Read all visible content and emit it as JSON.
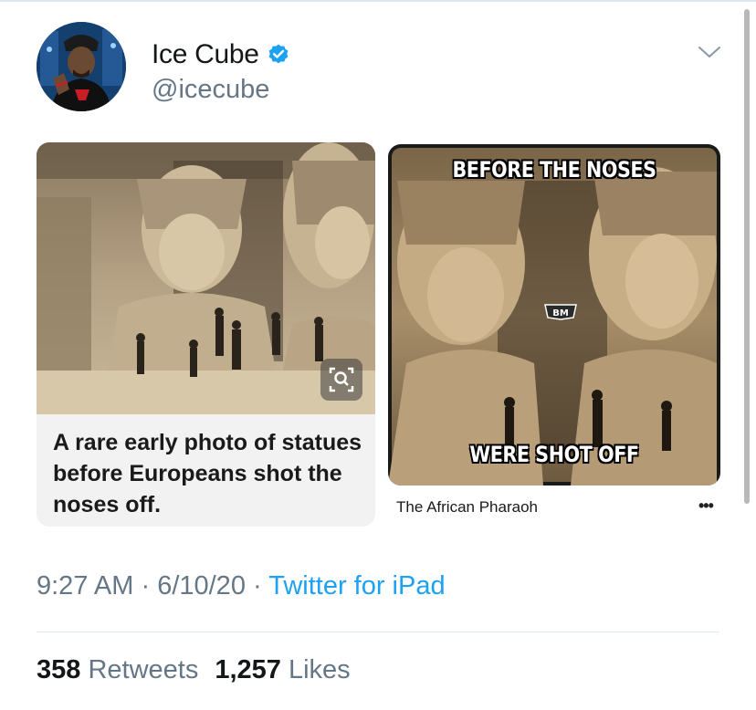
{
  "tweet": {
    "author": {
      "name": "Ice Cube",
      "handle": "@icecube",
      "verified": true
    },
    "media": {
      "left_card": {
        "caption": "A rare early photo of statues before Europeans shot the noses off."
      },
      "right_card": {
        "top_text": "BEFORE THE NOSES",
        "bottom_text": "WERE SHOT OFF",
        "badge": "BM",
        "source": "The African Pharaoh",
        "more": "•••"
      }
    },
    "meta": {
      "time": "9:27 AM",
      "sep1": " · ",
      "date": "6/10/20",
      "sep2": " · ",
      "source": "Twitter for iPad"
    },
    "stats": {
      "retweets_count": "358",
      "retweets_label": "Retweets",
      "likes_count": "1,257",
      "likes_label": "Likes"
    }
  },
  "colors": {
    "link": "#1da1f2",
    "secondary_text": "#657786",
    "divider": "#e1e8ed",
    "verified_badge": "#1da1f2"
  },
  "icons": [
    "verified-icon",
    "caret-down-icon",
    "zoom-icon"
  ]
}
